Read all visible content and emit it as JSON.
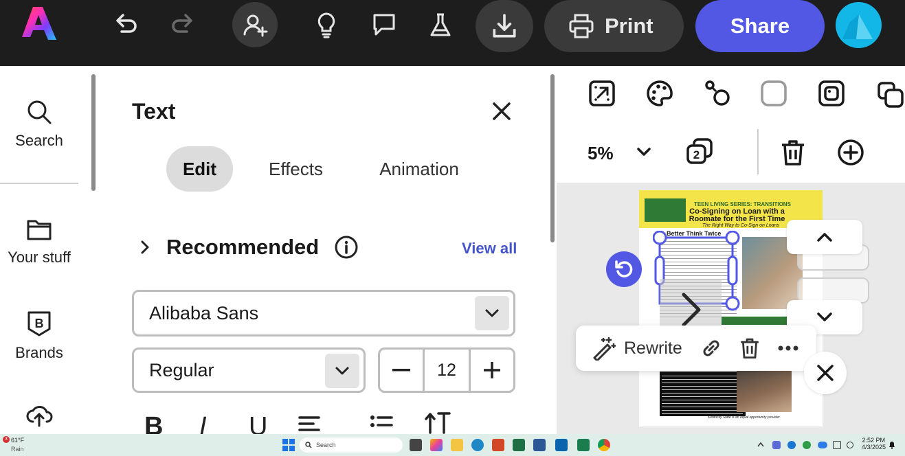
{
  "topbar": {
    "print_label": "Print",
    "share_label": "Share",
    "colors": {
      "background": "#1d1d1d",
      "share": "#5258e4",
      "avatar": "#12b7e8"
    }
  },
  "leftrail": {
    "items": [
      {
        "label": "Search",
        "icon": "search-icon"
      },
      {
        "label": "Your stuff",
        "icon": "folder-icon"
      },
      {
        "label": "Brands",
        "icon": "brand-icon"
      },
      {
        "label": "",
        "icon": "cloud-upload-icon"
      }
    ]
  },
  "panel": {
    "title": "Text",
    "tabs": [
      {
        "label": "Edit",
        "active": true
      },
      {
        "label": "Effects",
        "active": false
      },
      {
        "label": "Animation",
        "active": false
      }
    ],
    "recommended_label": "Recommended",
    "view_all": "View all",
    "font_family": "Alibaba Sans",
    "font_weight": "Regular",
    "font_size": "12",
    "format_buttons": [
      "B",
      "I",
      "U"
    ]
  },
  "canvas": {
    "zoom": "5%",
    "page_count_badge": "2",
    "document": {
      "series": "TEEN LIVING SERIES: TRANSITIONS",
      "title": "Co-Signing on Loan with a Roomate for the First Time",
      "subtitle": "The Right Way to Co-Sign on Loans",
      "heading": "Better Think Twice",
      "footer": "Kentucky State is an equal opportunity provider."
    },
    "context_menu": {
      "rewrite_label": "Rewrite"
    }
  },
  "taskbar": {
    "weather_temp": "61°F",
    "weather_desc": "Rain",
    "weather_badge": "3",
    "search_label": "Search",
    "time": "2:52 PM",
    "date": "4/3/2025"
  }
}
